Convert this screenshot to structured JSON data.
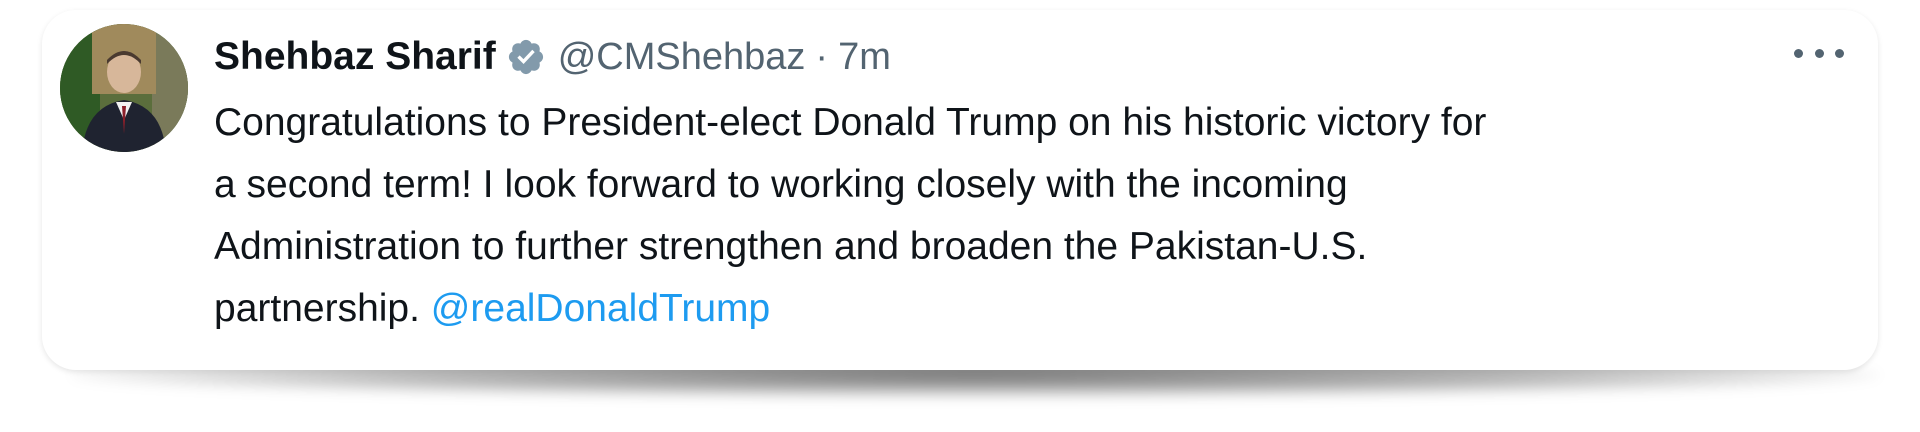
{
  "tweet": {
    "author_name": "Shehbaz Sharif",
    "handle": "@CMShehbaz",
    "separator": "·",
    "time": "7m",
    "text_lines": [
      "Congratulations to President-elect Donald Trump on his historic victory for",
      "a second term! I look forward to working closely with the incoming",
      "Administration to further strengthen and broaden the Pakistan-U.S.",
      "partnership. "
    ],
    "mention": "@realDonaldTrump",
    "verified_icon": "verified-badge-icon",
    "more_icon": "more-options-icon"
  },
  "colors": {
    "text": "#0f1419",
    "secondary": "#536471",
    "link": "#1d9bf0",
    "badge": "#829aab"
  }
}
